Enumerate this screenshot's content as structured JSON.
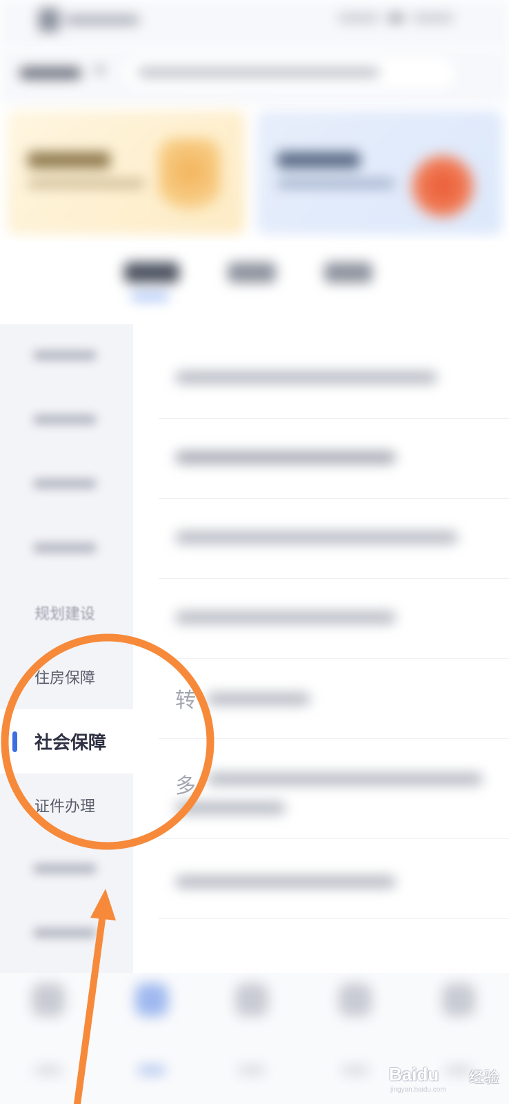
{
  "sidebar": {
    "items": [
      {
        "label": ""
      },
      {
        "label": ""
      },
      {
        "label": ""
      },
      {
        "label": ""
      },
      {
        "label": "规划建设"
      },
      {
        "label": "住房保障"
      },
      {
        "label": "社会保障"
      },
      {
        "label": "证件办理"
      },
      {
        "label": ""
      },
      {
        "label": ""
      }
    ],
    "active_index": 6
  },
  "content": {
    "partial_row_1": "转",
    "partial_row_2": "多"
  },
  "watermark": {
    "brand": "Baidu",
    "cn": "经验",
    "url": "jingyan.baidu.com"
  },
  "colors": {
    "accent": "#3d6ee0",
    "annotation": "#f68a3a",
    "sidebar_bg": "#f3f4f8"
  }
}
